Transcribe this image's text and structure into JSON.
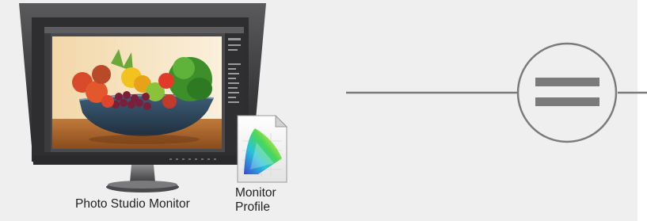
{
  "monitor": {
    "label": "Photo Studio Monitor"
  },
  "profile": {
    "label_line1": "Monitor",
    "label_line2": "Profile"
  },
  "connector": {
    "symbol": "equals-icon"
  },
  "colors": {
    "panel_bg": "#efefef",
    "bezel": "#3c3c3e",
    "connector": "#7b7b7b"
  }
}
